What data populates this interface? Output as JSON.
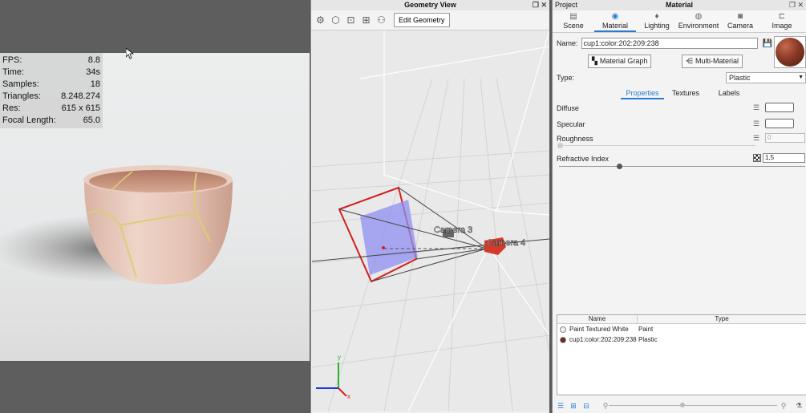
{
  "render_view": {
    "stats": [
      {
        "label": "FPS:",
        "value": "8.8"
      },
      {
        "label": "Time:",
        "value": "34s"
      },
      {
        "label": "Samples:",
        "value": "18"
      },
      {
        "label": "Triangles:",
        "value": "8.248.274"
      },
      {
        "label": "Res:",
        "value": "615 x 615"
      },
      {
        "label": "Focal Length:",
        "value": "65.0"
      }
    ]
  },
  "geometry_view": {
    "title": "Geometry View",
    "edit_button": "Edit Geometry",
    "camera_labels": [
      "Camera 3",
      "Camera 4"
    ],
    "axis_labels": {
      "x": "x",
      "y": "y"
    }
  },
  "material_panel": {
    "project_label": "Project",
    "title": "Material",
    "tabs": [
      {
        "label": "Scene",
        "icon": "scene-icon"
      },
      {
        "label": "Material",
        "icon": "material-icon"
      },
      {
        "label": "Lighting",
        "icon": "lighting-icon"
      },
      {
        "label": "Environment",
        "icon": "environment-icon"
      },
      {
        "label": "Camera",
        "icon": "camera-icon"
      },
      {
        "label": "Image",
        "icon": "image-icon"
      }
    ],
    "active_tab": "Material",
    "name_label": "Name:",
    "name_value": "cup1:color:202:209:238",
    "material_graph_button": "Material Graph",
    "multi_material_button": "Multi-Material",
    "type_label": "Type:",
    "type_value": "Plastic",
    "sub_tabs": [
      "Properties",
      "Textures",
      "Labels"
    ],
    "active_sub_tab": "Properties",
    "properties": {
      "diffuse": "Diffuse",
      "specular": "Specular",
      "roughness": "Roughness",
      "roughness_value": "0",
      "refractive_index": "Refractive Index",
      "refractive_value": "1,5"
    },
    "splitter": "...",
    "table": {
      "columns": [
        "Name",
        "Type"
      ],
      "rows": [
        {
          "name": "Paint Textured White",
          "type": "Paint",
          "color": "#f2f2f2"
        },
        {
          "name": "cup1:color:202:209:238",
          "type": "Plastic",
          "color": "#6b2a1c"
        }
      ]
    }
  }
}
